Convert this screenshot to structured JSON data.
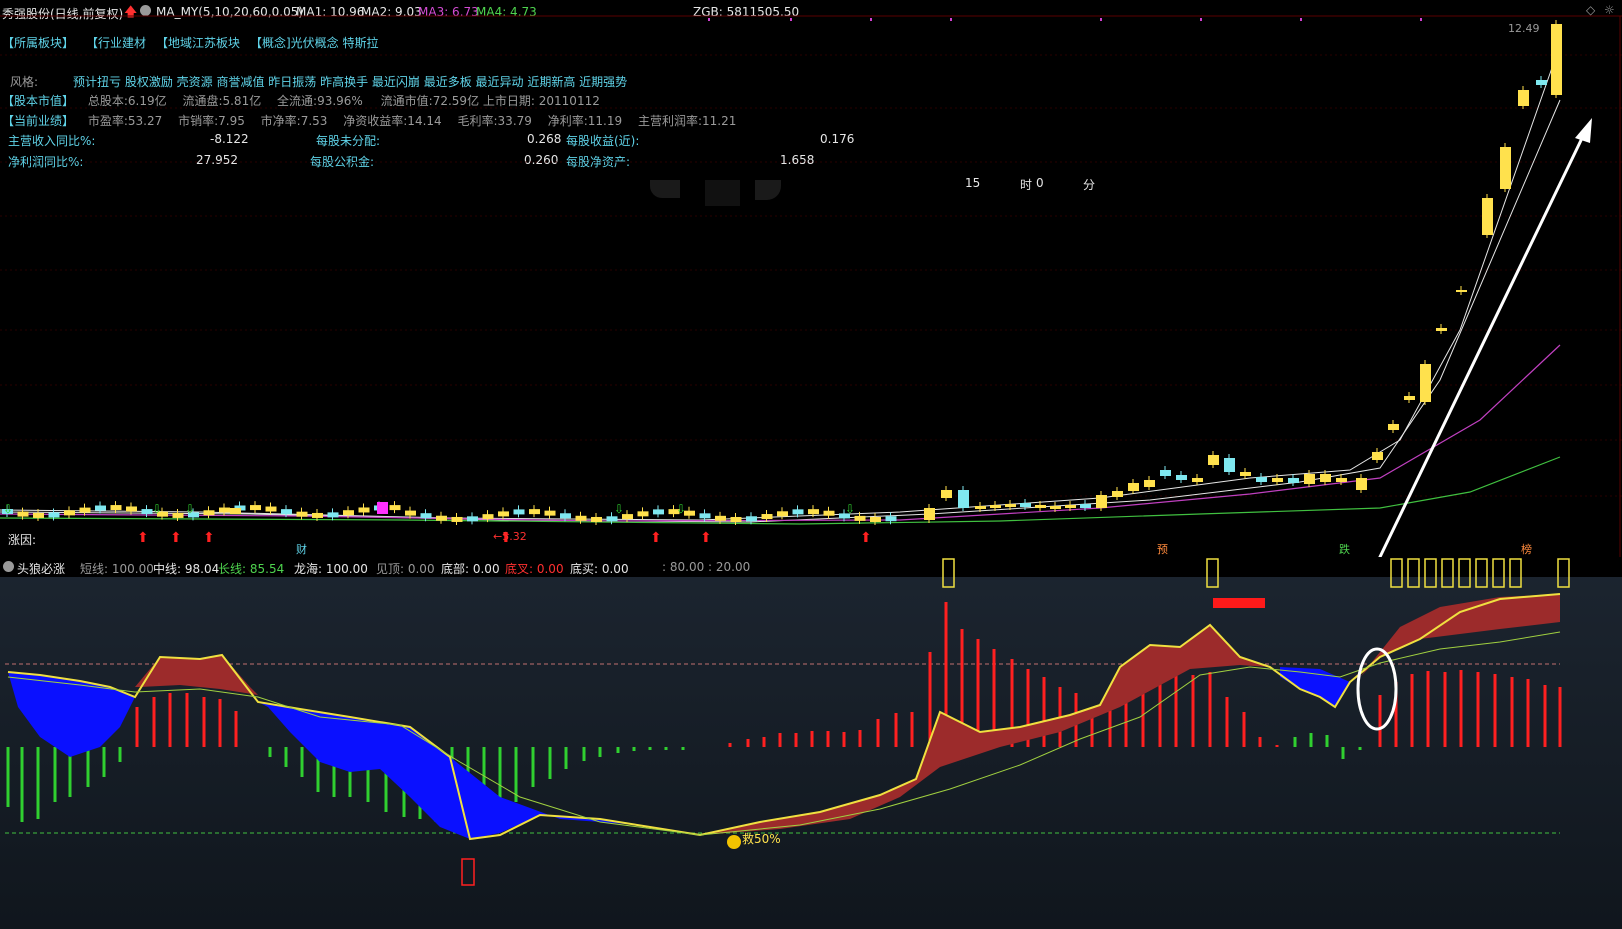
{
  "header": {
    "stock_title": "秀强股份(日线,前复权)",
    "indicator_name": "MA_MY(5,10,20,60,0.05)",
    "ma1": "MA1: 10.96",
    "ma2": "MA2: 9.03",
    "ma3": "MA3: 6.73",
    "ma4": "MA4: 4.73",
    "zgb": "ZGB: 5811505.50"
  },
  "sectors": {
    "belong": "【所属板块】",
    "industry": "【行业建材",
    "region": "【地域江苏板块",
    "concept": "【概念]光伏概念 特斯拉"
  },
  "style": {
    "label": "风格:",
    "tags": "预计扭亏 股权激励 壳资源 商誉减值 昨日振荡 昨高换手 最近闪崩 最近多板 最近异动 近期新高 近期强势"
  },
  "equity": {
    "label": "【股本市值】",
    "total_shares": "总股本:6.19亿",
    "float_shares": "流通盘:5.81亿",
    "full_float": "全流通:93.96%",
    "float_mv": "流通市值:72.59亿",
    "listing_date": "上市日期: 20110112"
  },
  "performance": {
    "label": "【当前业绩】",
    "pe": "市盈率:53.27",
    "ps": "市销率:7.95",
    "pb": "市净率:7.53",
    "roe": "净资收益率:14.14",
    "gross_margin": "毛利率:33.79",
    "net_margin": "净利率:11.19",
    "op_margin": "主营利润率:11.21"
  },
  "fundamentals": {
    "rev_yoy_label": "主营收入同比%:",
    "rev_yoy": "-8.122",
    "undist_label": "每股未分配:",
    "undist": "0.268",
    "eps_label": "每股收益(近):",
    "eps": "0.176",
    "np_yoy_label": "净利润同比%:",
    "np_yoy": "27.952",
    "capres_label": "每股公积金:",
    "capres": "0.260",
    "bvps_label": "每股净资产:",
    "bvps": "1.658"
  },
  "timer": {
    "hours": "15",
    "hour_unit": "时",
    "minutes": "0",
    "minute_unit": "分"
  },
  "price_high_label": "12.49",
  "rise_reason": "涨因:",
  "bottom_labels": {
    "cai": "财",
    "yu": "预",
    "die": "跌",
    "bang": "榜"
  },
  "sub_header": {
    "name": "头狼必涨",
    "short": "短线: 100.00",
    "mid": "中线: 98.04",
    "long": "长线: 85.54",
    "dragon": "龙海: 100.00",
    "top": "见顶: 0.00",
    "bottom": "底部: 0.00",
    "bottom_cross": "底叉: 0.00",
    "bottom_buy": "底买: 0.00",
    "levels": ": 80.00 : 20.00"
  },
  "sub_annotation": "救50%",
  "low_label": "5.32",
  "colors": {
    "up_candle": "#ffe14d",
    "down_candle": "#7fe8f0",
    "ma_white": "#e6e6e6",
    "ma_magenta": "#c040c0",
    "ma_green": "#40c040",
    "fill_red": "#9c2b2b",
    "fill_blue": "#0a10ff",
    "bar_red": "#ff2020",
    "bar_green": "#30d030"
  }
}
